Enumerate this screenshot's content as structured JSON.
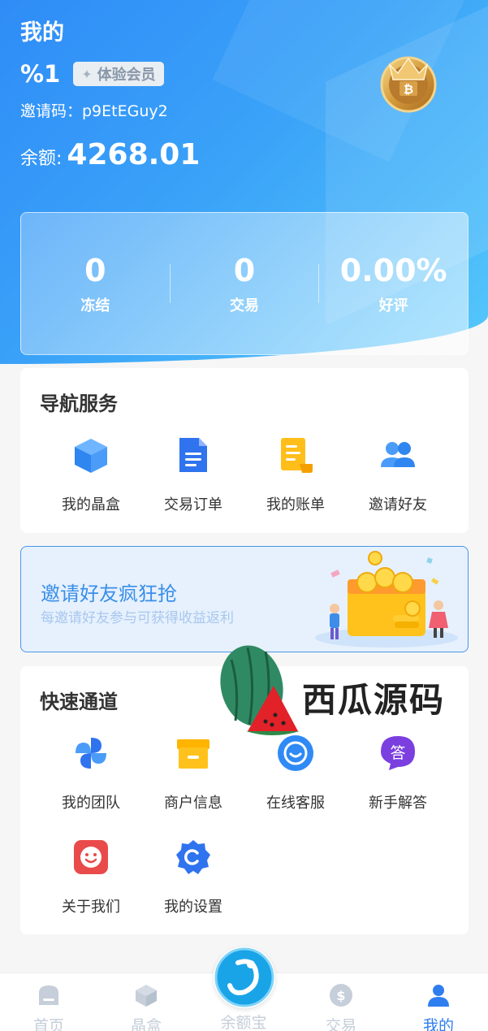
{
  "header": {
    "title": "我的",
    "username": "%1",
    "member_badge": "体验会员",
    "invite_code": "邀请码：p9EtEGuy2",
    "balance_label": "余额:",
    "balance_value": "4268.01"
  },
  "stats": [
    {
      "value": "0",
      "label": "冻结"
    },
    {
      "value": "0",
      "label": "交易"
    },
    {
      "value": "0.00%",
      "label": "好评"
    }
  ],
  "nav_service": {
    "title": "导航服务",
    "items": [
      {
        "label": "我的晶盒",
        "icon": "cube-icon"
      },
      {
        "label": "交易订单",
        "icon": "document-icon"
      },
      {
        "label": "我的账单",
        "icon": "bill-icon"
      },
      {
        "label": "邀请好友",
        "icon": "users-icon"
      }
    ]
  },
  "banner": {
    "title": "邀请好友疯狂抢",
    "subtitle": "每邀请好友参与可获得收益返利"
  },
  "quick_channel": {
    "title": "快速通道",
    "items": [
      {
        "label": "我的团队",
        "icon": "pinwheel-icon"
      },
      {
        "label": "商户信息",
        "icon": "shop-icon"
      },
      {
        "label": "在线客服",
        "icon": "chat-icon"
      },
      {
        "label": "新手解答",
        "icon": "answer-icon"
      },
      {
        "label": "关于我们",
        "icon": "smile-icon"
      },
      {
        "label": "我的设置",
        "icon": "settings-icon"
      }
    ]
  },
  "watermark": {
    "text": "西瓜源码"
  },
  "tabbar": {
    "items": [
      {
        "label": "首页",
        "icon": "home-icon"
      },
      {
        "label": "晶盒",
        "icon": "cube-icon"
      },
      {
        "label": "余额宝",
        "icon": "logo-icon"
      },
      {
        "label": "交易",
        "icon": "dollar-icon"
      },
      {
        "label": "我的",
        "icon": "person-icon"
      }
    ],
    "active_index": 4
  },
  "colors": {
    "accent": "#2f7ef0",
    "header_start": "#2f8cf7",
    "header_end": "#55c8fb"
  }
}
